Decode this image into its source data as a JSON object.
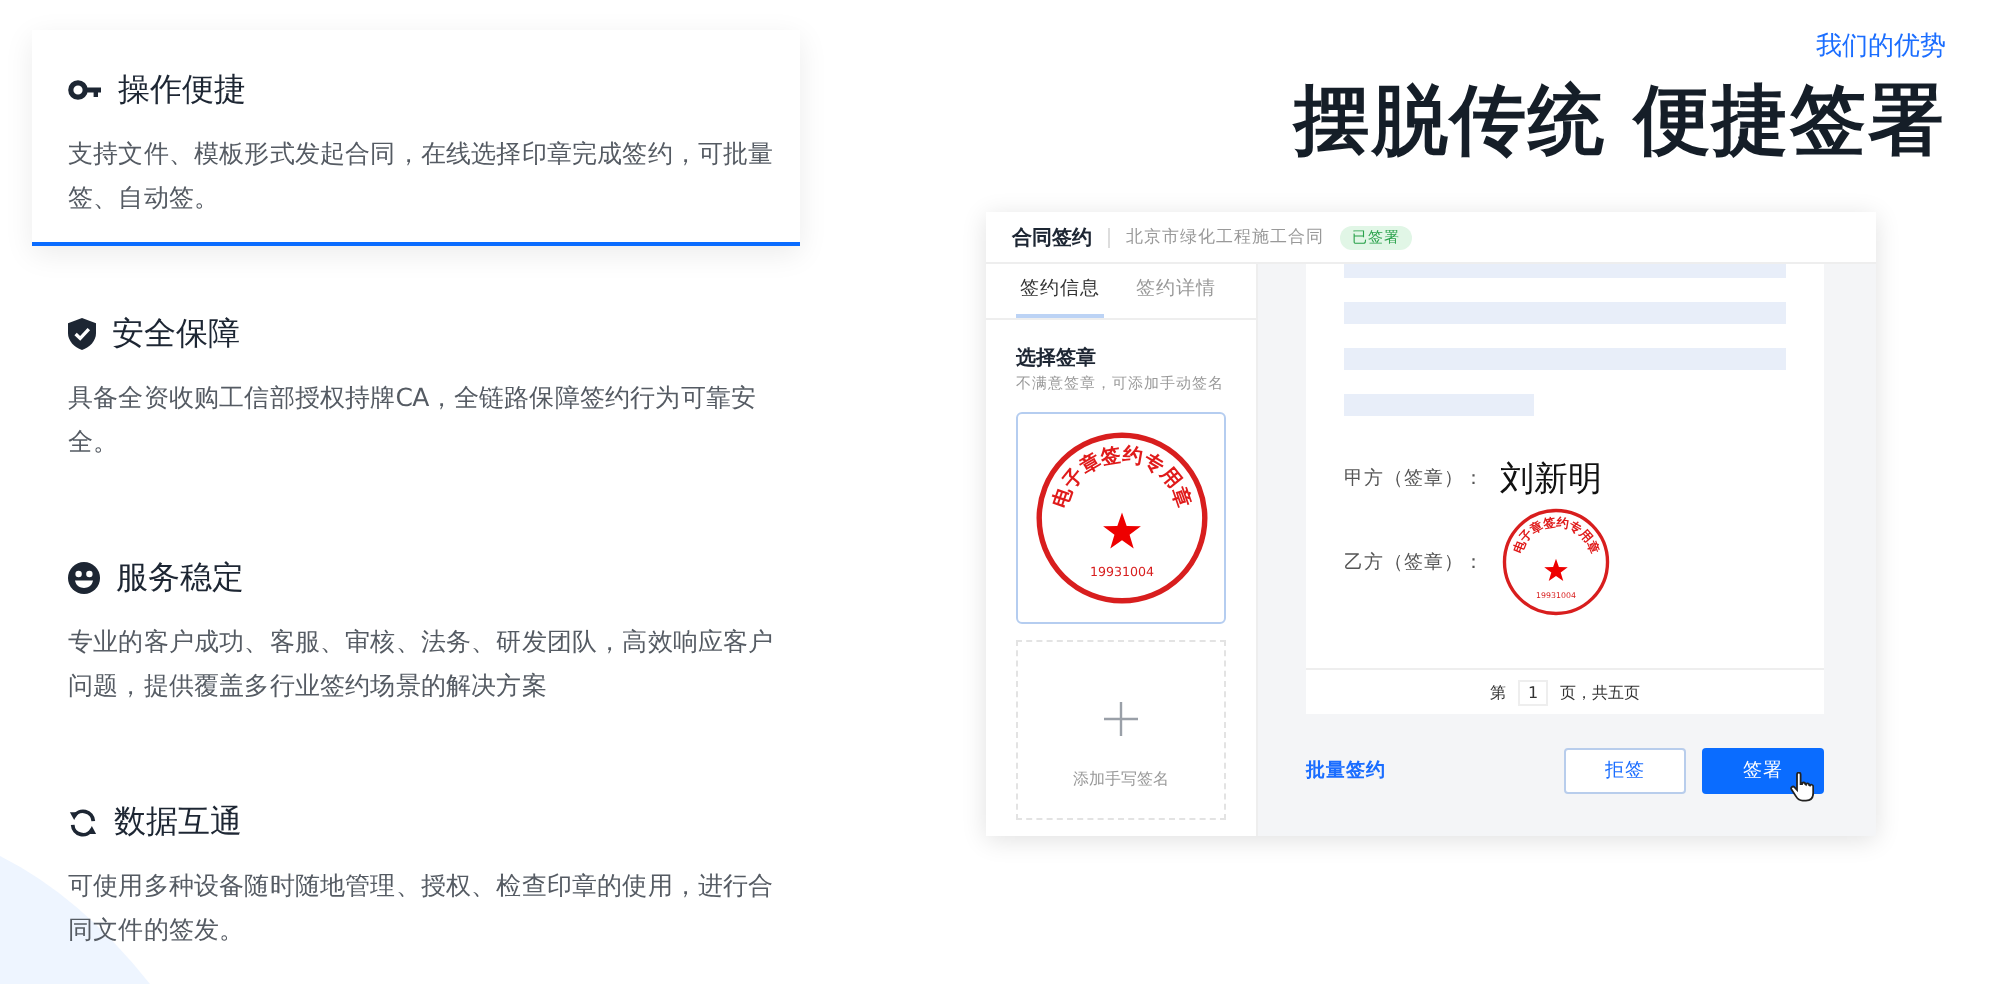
{
  "header": {
    "eyebrow": "我们的优势",
    "title": "摆脱传统 便捷签署"
  },
  "features": [
    {
      "title": "操作便捷",
      "description": "支持文件、模板形式发起合同，在线选择印章完成签约，可批量签、自动签。",
      "selected": true
    },
    {
      "title": "安全保障",
      "description": "具备全资收购工信部授权持牌CA，全链路保障签约行为可靠安全。",
      "selected": false
    },
    {
      "title": "服务稳定",
      "description": "专业的客户成功、客服、审核、法务、研发团队，高效响应客户问题，提供覆盖多行业签约场景的解决方案",
      "selected": false
    },
    {
      "title": "数据互通",
      "description": "可使用多种设备随时随地管理、授权、检查印章的使用，进行合同文件的签发。",
      "selected": false
    }
  ],
  "mockup": {
    "app_title": "合同签约",
    "contract_name": "北京市绿化工程施工合同",
    "status": "已签署",
    "tabs": [
      {
        "label": "签约信息",
        "selected": true
      },
      {
        "label": "签约详情",
        "selected": false
      }
    ],
    "section_title": "选择签章",
    "section_hint": "不满意签章，可添加手动签名",
    "seal": {
      "ring_text": "电子章签约专用章",
      "serial": "19931004"
    },
    "add_signature": "添加手写签名",
    "party_a_label": "甲方（签章）：",
    "party_a_signature": "刘新明",
    "party_b_label": "乙方（签章）：",
    "party_b_seal": {
      "ring_text": "电子章签约专用章",
      "serial": "19931004"
    },
    "pager": {
      "prefix": "第",
      "page": "1",
      "suffix": "页，共五页"
    },
    "batch_link": "批量签约",
    "reject_button": "拒签",
    "sign_button": "签署"
  }
}
